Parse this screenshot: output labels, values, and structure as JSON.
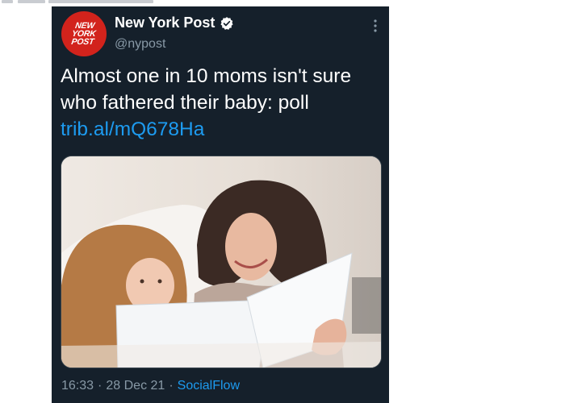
{
  "tweet": {
    "author_name": "New York Post",
    "handle": "@nypost",
    "avatar_logo": [
      "NEW",
      "YORK",
      "POST"
    ],
    "text": "Almost one in 10 moms isn't sure who fathered their baby: poll",
    "link": "trib.al/mQ678Ha",
    "time": "16:33",
    "date": "28 Dec 21",
    "separator": "·",
    "source": "SocialFlow",
    "icons": {
      "verified": "verified-badge-icon",
      "more": "more-vertical-icon"
    },
    "colors": {
      "card_bg": "#15202b",
      "link": "#1d9bf0",
      "muted": "#8899a6",
      "avatar_bg": "#d2231c"
    }
  }
}
